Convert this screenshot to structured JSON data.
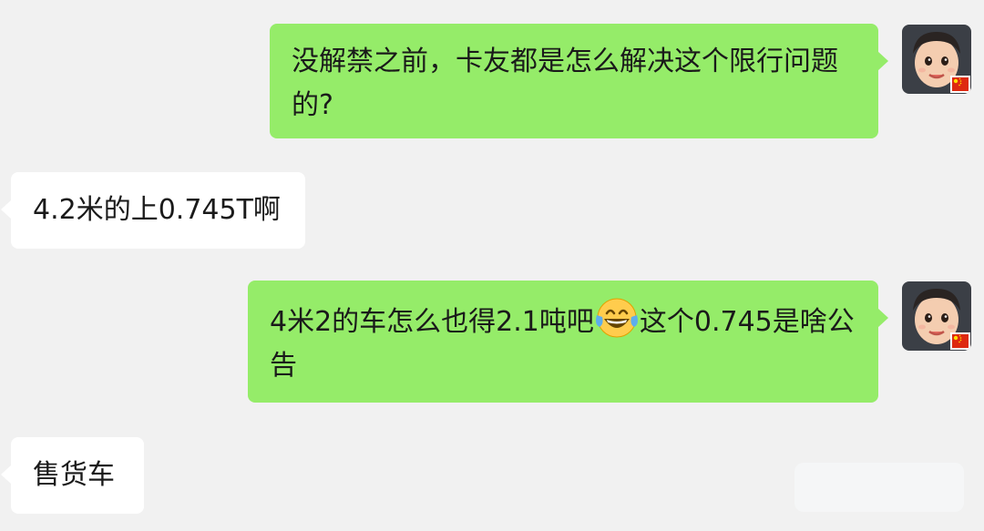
{
  "chat": {
    "messages": [
      {
        "side": "sent",
        "text": "没解禁之前，卡友都是怎么解决这个限行问题的?"
      },
      {
        "side": "received",
        "text": "4.2米的上0.745T啊"
      },
      {
        "side": "sent",
        "text_before": "4米2的车怎么也得2.1吨吧",
        "emoji": "face-with-tears-of-joy",
        "text_after": "这个0.745是啥公告"
      },
      {
        "side": "received",
        "text": "售货车"
      }
    ]
  },
  "colors": {
    "background": "#f1f1f1",
    "sent_bubble": "#95ec69",
    "received_bubble": "#ffffff",
    "text": "#1a1a1a"
  },
  "icons": {
    "avatar": "user-avatar-boy",
    "flag_badge": "china-flag-icon",
    "emoji": "face-with-tears-of-joy"
  }
}
